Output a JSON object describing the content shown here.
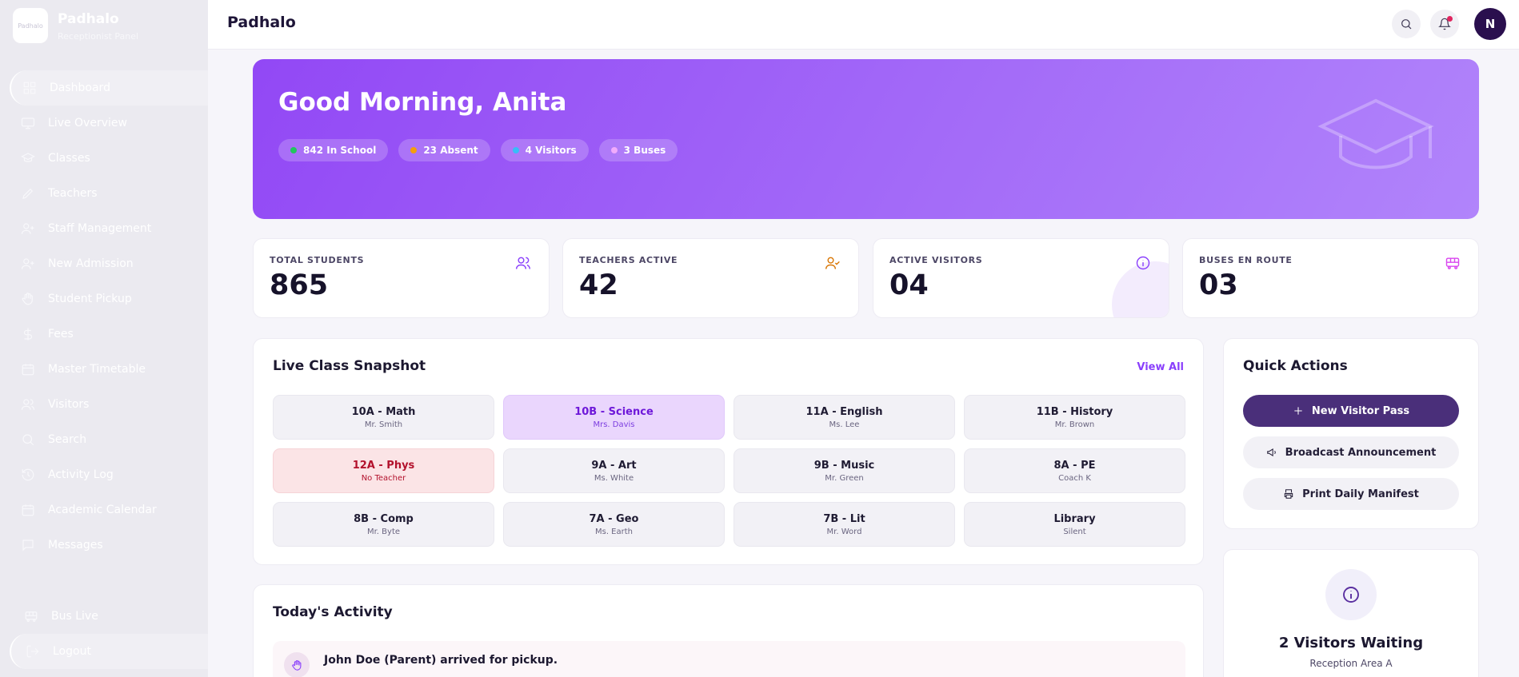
{
  "brand": {
    "name": "Padhalo",
    "subtitle": "Receptionist Panel",
    "logo_text": "Padhalo"
  },
  "sidebar": {
    "items": [
      {
        "label": "Dashboard",
        "icon": "dashboard-icon",
        "active": true
      },
      {
        "label": "Live Overview",
        "icon": "monitor-icon"
      },
      {
        "label": "Classes",
        "icon": "graduation-cap-icon"
      },
      {
        "label": "Teachers",
        "icon": "pen-icon"
      },
      {
        "label": "Staff Management",
        "icon": "user-plus-icon"
      },
      {
        "label": "New Admission",
        "icon": "user-plus-icon"
      },
      {
        "label": "Student Pickup",
        "icon": "hand-icon"
      },
      {
        "label": "Fees",
        "icon": "dollar-icon"
      },
      {
        "label": "Master Timetable",
        "icon": "calendar-icon"
      },
      {
        "label": "Visitors",
        "icon": "users-icon"
      },
      {
        "label": "Search",
        "icon": "search-icon"
      },
      {
        "label": "Activity Log",
        "icon": "history-icon"
      },
      {
        "label": "Academic Calendar",
        "icon": "calendar-icon"
      },
      {
        "label": "Messages",
        "icon": "message-icon"
      }
    ],
    "bottom": [
      {
        "label": "Bus Live",
        "icon": "bus-icon"
      },
      {
        "label": "Logout",
        "icon": "logout-icon"
      }
    ]
  },
  "header": {
    "title": "Padhalo",
    "avatar_initial": "N"
  },
  "hero": {
    "greeting": "Good Morning, Anita",
    "chips": [
      {
        "label": "842 In School",
        "color": "#22c55e"
      },
      {
        "label": "23 Absent",
        "color": "#f59e0b"
      },
      {
        "label": "4 Visitors",
        "color": "#38bdf8"
      },
      {
        "label": "3 Buses",
        "color": "#f0abfc"
      }
    ]
  },
  "stats": [
    {
      "label": "TOTAL STUDENTS",
      "value": "865",
      "icon": "users-icon",
      "color": "#8a3ffc"
    },
    {
      "label": "TEACHERS ACTIVE",
      "value": "42",
      "icon": "user-check-icon",
      "color": "#d97706"
    },
    {
      "label": "ACTIVE VISITORS",
      "value": "04",
      "icon": "info-icon",
      "color": "#8a3ffc"
    },
    {
      "label": "BUSES EN ROUTE",
      "value": "03",
      "icon": "bus-icon",
      "color": "#d946ef"
    }
  ],
  "snapshot": {
    "title": "Live Class Snapshot",
    "view_all": "View All",
    "classes": [
      {
        "name": "10A - Math",
        "teacher": "Mr. Smith",
        "state": "normal"
      },
      {
        "name": "10B - Science",
        "teacher": "Mrs. Davis",
        "state": "highlight"
      },
      {
        "name": "11A - English",
        "teacher": "Ms. Lee",
        "state": "normal"
      },
      {
        "name": "11B - History",
        "teacher": "Mr. Brown",
        "state": "normal"
      },
      {
        "name": "12A - Phys",
        "teacher": "No Teacher",
        "state": "warning"
      },
      {
        "name": "9A - Art",
        "teacher": "Ms. White",
        "state": "normal"
      },
      {
        "name": "9B - Music",
        "teacher": "Mr. Green",
        "state": "normal"
      },
      {
        "name": "8A - PE",
        "teacher": "Coach K",
        "state": "normal"
      },
      {
        "name": "8B - Comp",
        "teacher": "Mr. Byte",
        "state": "normal"
      },
      {
        "name": "7A - Geo",
        "teacher": "Ms. Earth",
        "state": "normal"
      },
      {
        "name": "7B - Lit",
        "teacher": "Mr. Word",
        "state": "normal"
      },
      {
        "name": "Library",
        "teacher": "Silent",
        "state": "normal"
      }
    ]
  },
  "quick_actions": {
    "title": "Quick Actions",
    "new_visitor": "New Visitor Pass",
    "broadcast": "Broadcast Announcement",
    "print_manifest": "Print Daily Manifest"
  },
  "activity": {
    "title": "Today's Activity",
    "items": [
      {
        "text": "John Doe (Parent) arrived for pickup.",
        "icon": "hand-icon"
      }
    ]
  },
  "waiting": {
    "title": "2 Visitors Waiting",
    "subtitle": "Reception Area A"
  }
}
